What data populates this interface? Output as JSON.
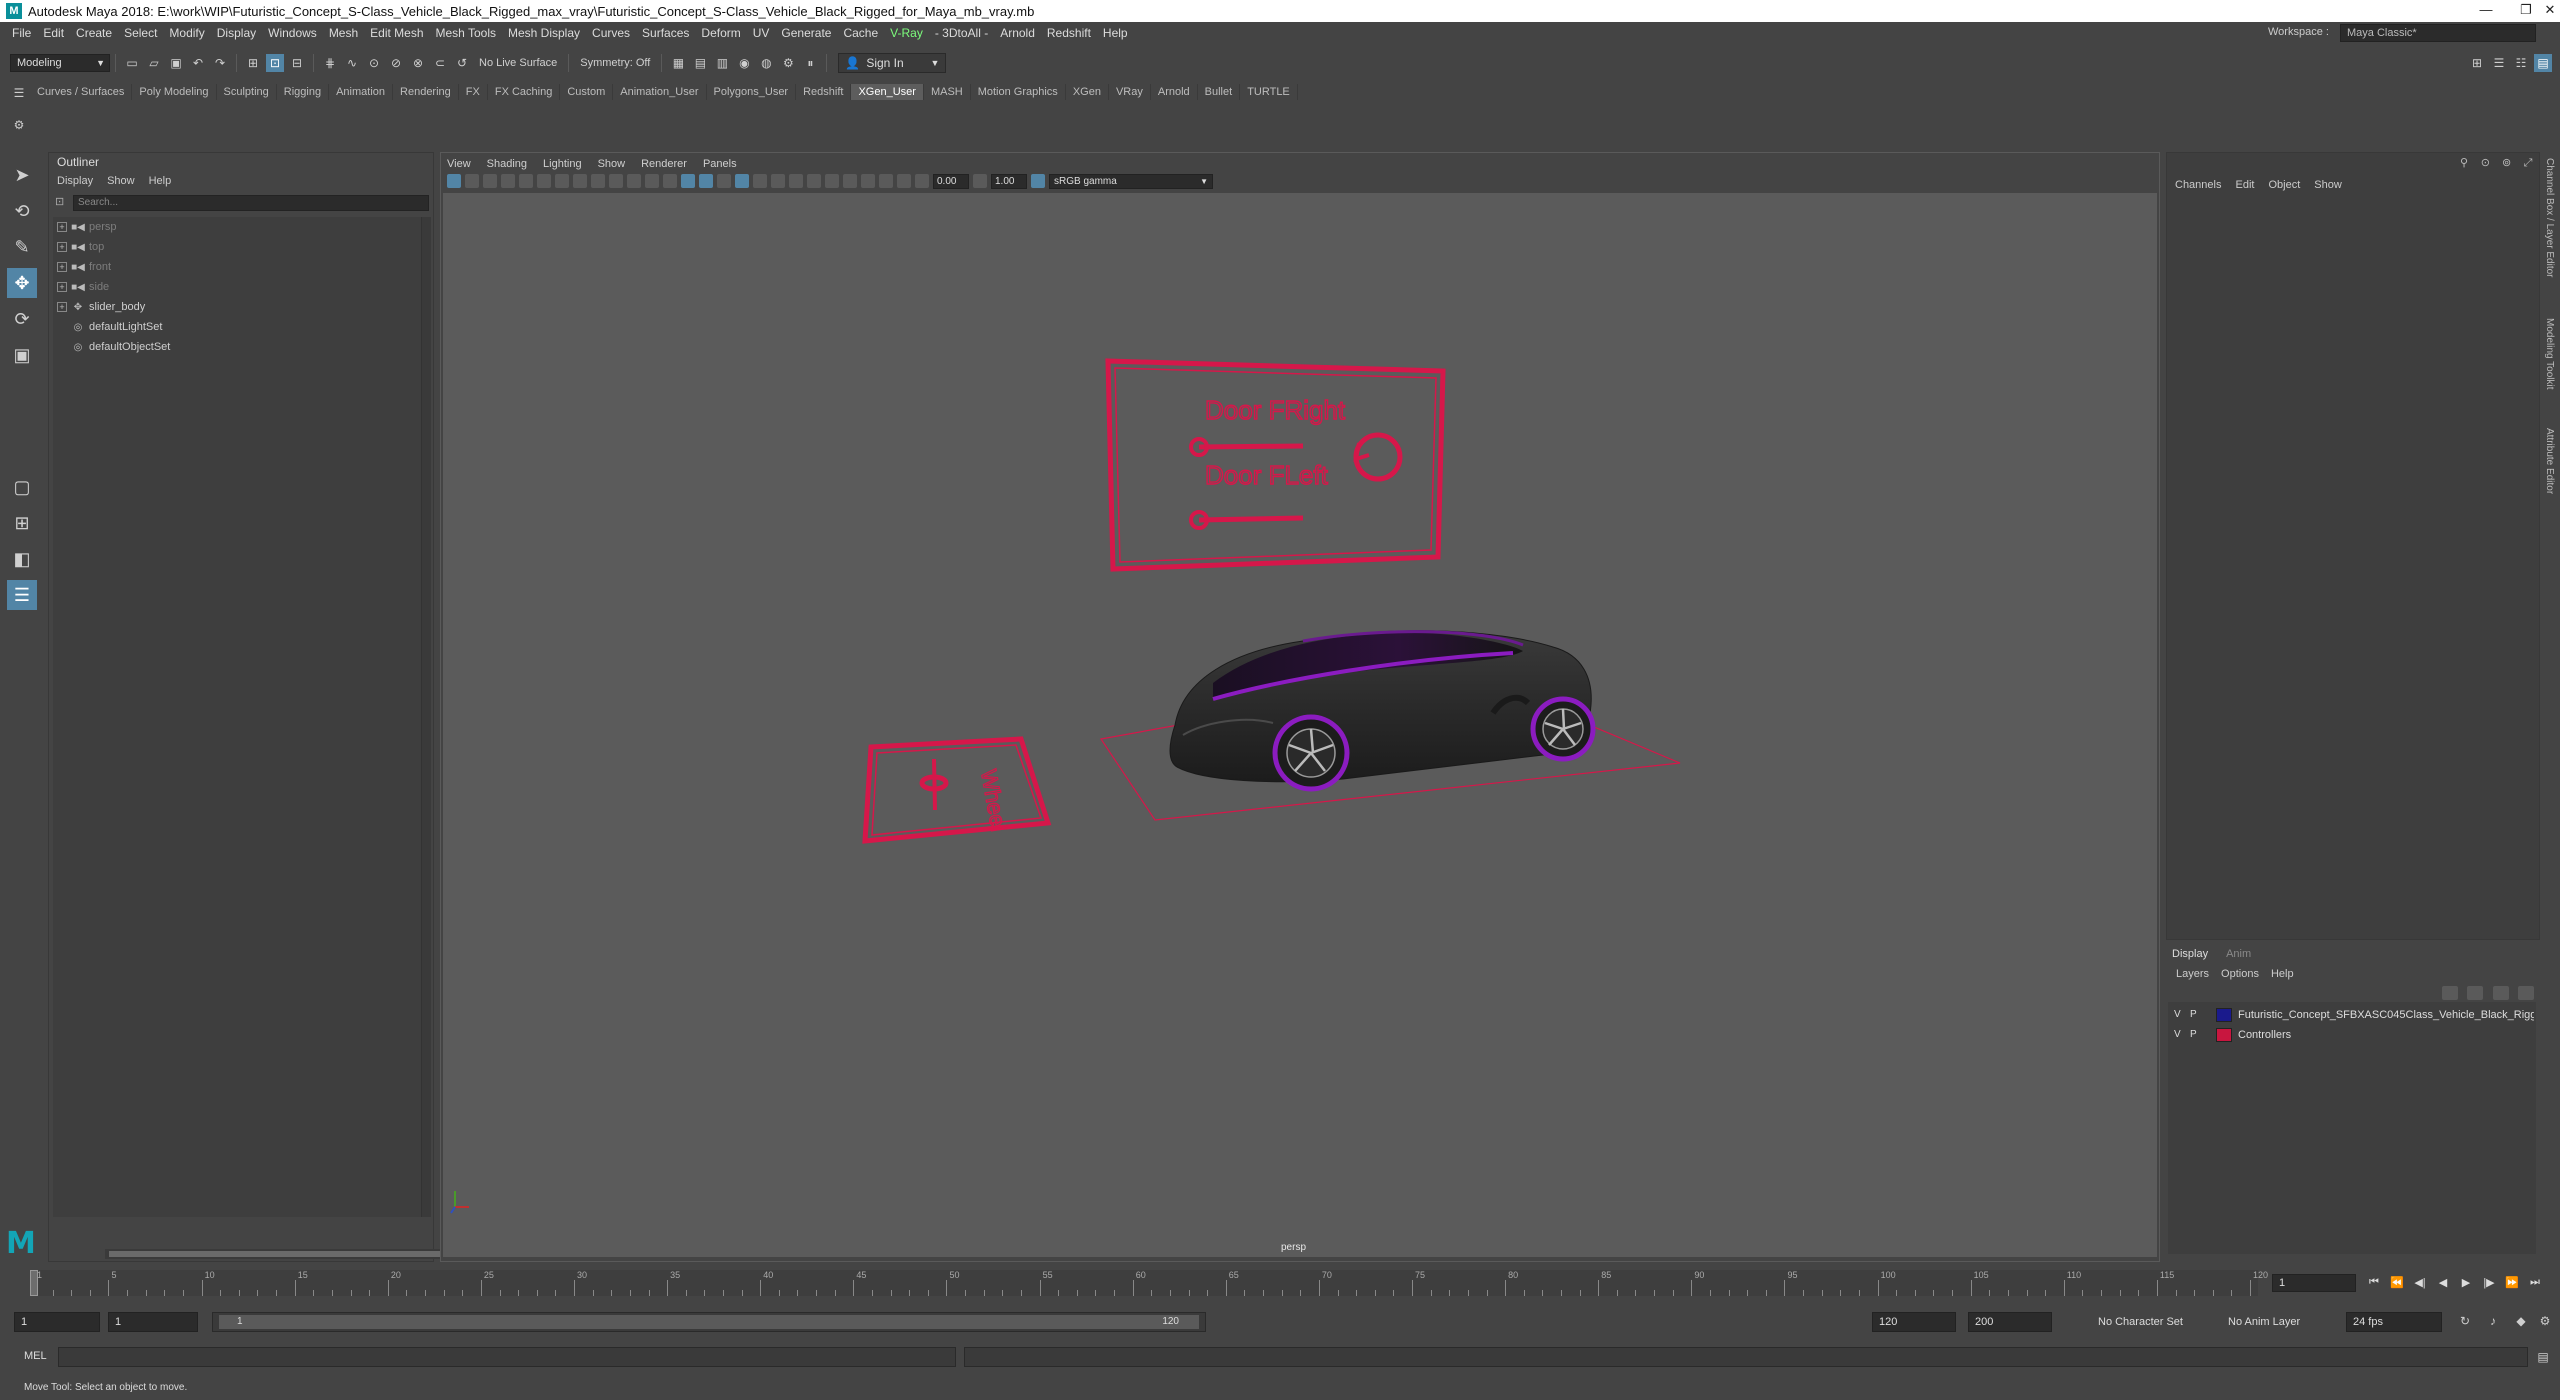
{
  "titlebar": {
    "title": "Autodesk Maya 2018: E:\\work\\WIP\\Futuristic_Concept_S-Class_Vehicle_Black_Rigged_max_vray\\Futuristic_Concept_S-Class_Vehicle_Black_Rigged_for_Maya_mb_vray.mb",
    "app_icon": "M",
    "minimize": "—",
    "maximize": "❐",
    "close": "✕"
  },
  "menubar": {
    "items": [
      "File",
      "Edit",
      "Create",
      "Select",
      "Modify",
      "Display",
      "Windows",
      "Mesh",
      "Edit Mesh",
      "Mesh Tools",
      "Mesh Display",
      "Curves",
      "Surfaces",
      "Deform",
      "UV",
      "Generate",
      "Cache",
      "V-Ray",
      "- 3DtoAll -",
      "Arnold",
      "Redshift",
      "Help"
    ],
    "workspace_label": "Workspace :",
    "workspace_value": "Maya Classic*"
  },
  "statusline": {
    "mode": "Modeling",
    "live_surface": "No Live Surface",
    "symmetry": "Symmetry: Off",
    "sign_in": "Sign In"
  },
  "shelf": {
    "tabs": [
      "Curves / Surfaces",
      "Poly Modeling",
      "Sculpting",
      "Rigging",
      "Animation",
      "Rendering",
      "FX",
      "FX Caching",
      "Custom",
      "Animation_User",
      "Polygons_User",
      "Redshift",
      "XGen_User",
      "MASH",
      "Motion Graphics",
      "XGen",
      "VRay",
      "Arnold",
      "Bullet",
      "TURTLE"
    ],
    "active": "XGen_User"
  },
  "outliner": {
    "title": "Outliner",
    "menu": [
      "Display",
      "Show",
      "Help"
    ],
    "search_placeholder": "Search...",
    "items": [
      {
        "label": "persp",
        "icon": "camera-icon",
        "dim": true,
        "expandable": true
      },
      {
        "label": "top",
        "icon": "camera-icon",
        "dim": true,
        "expandable": true
      },
      {
        "label": "front",
        "icon": "camera-icon",
        "dim": true,
        "expandable": true
      },
      {
        "label": "side",
        "icon": "camera-icon",
        "dim": true,
        "expandable": true
      },
      {
        "label": "slider_body",
        "icon": "transform-icon",
        "dim": false,
        "expandable": true
      },
      {
        "label": "defaultLightSet",
        "icon": "set-icon",
        "dim": false,
        "expandable": false
      },
      {
        "label": "defaultObjectSet",
        "icon": "set-icon",
        "dim": false,
        "expandable": false
      }
    ]
  },
  "viewport": {
    "menu": [
      "View",
      "Shading",
      "Lighting",
      "Show",
      "Renderer",
      "Panels"
    ],
    "exposure": "0.00",
    "gamma_value": "1.00",
    "color_space": "sRGB gamma",
    "camera": "persp",
    "controller_labels": {
      "door_right": "Door FRight",
      "door_left": "Door FLeft",
      "wheel": "Wheel"
    },
    "colors": {
      "controller": "#d6174a",
      "background": "#5b5b5b",
      "car_body": "#2a2a2a",
      "car_accent": "#8b1cc0"
    }
  },
  "channel_box": {
    "menu": [
      "Channels",
      "Edit",
      "Object",
      "Show"
    ]
  },
  "layer_editor": {
    "tabs": [
      "Display",
      "Anim"
    ],
    "menu": [
      "Layers",
      "Options",
      "Help"
    ],
    "layers": [
      {
        "v": "V",
        "p": "P",
        "name": "Futuristic_Concept_SFBXASC045Class_Vehicle_Black_Rigged",
        "color": "#1a1a8c"
      },
      {
        "v": "V",
        "p": "P",
        "name": "Controllers",
        "color": "#c8163f"
      }
    ]
  },
  "side_tabs": [
    "Channel Box / Layer Editor",
    "Modeling Toolkit",
    "Attribute Editor"
  ],
  "timeslider": {
    "ticks": [
      "1",
      "5",
      "10",
      "15",
      "20",
      "25",
      "30",
      "35",
      "40",
      "45",
      "50",
      "55",
      "60",
      "65",
      "70",
      "75",
      "80",
      "85",
      "90",
      "95",
      "100",
      "105",
      "110",
      "115",
      "120"
    ],
    "current_frame": "1",
    "playback_buttons": [
      "⏮",
      "⏪",
      "◀|",
      "◀",
      "▶",
      "|▶",
      "⏩",
      "⏭"
    ]
  },
  "range": {
    "start": "1",
    "playback_start": "1",
    "slider_start": "1",
    "slider_end": "120",
    "playback_end": "120",
    "end": "200",
    "character_set": "No Character Set",
    "anim_layer": "No Anim Layer",
    "fps": "24 fps"
  },
  "mel": {
    "label": "MEL"
  },
  "help_line": "Move Tool: Select an object to move."
}
